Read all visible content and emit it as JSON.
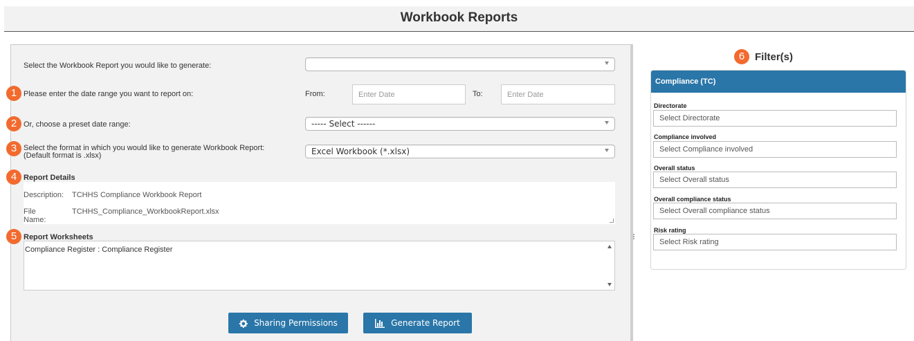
{
  "page": {
    "title": "Workbook Reports"
  },
  "form": {
    "report_select_label": "Select the Workbook Report you would like to generate:",
    "report_select_value": "",
    "date_range_label": "Please enter the date range you want to report on:",
    "from_label": "From:",
    "to_label": "To:",
    "from_placeholder": "Enter Date",
    "to_placeholder": "Enter Date",
    "preset_label": "Or, choose a preset date range:",
    "preset_value": "----- Select ------",
    "format_label_line1": "Select the format in which you would like to generate Workbook Report:",
    "format_label_line2": "(Default format is .xlsx)",
    "format_value": "Excel Workbook (*.xlsx)"
  },
  "badges": [
    "1",
    "2",
    "3",
    "4",
    "5",
    "6"
  ],
  "details": {
    "title": "Report Details",
    "description_label": "Description:",
    "description_value": "TCHHS Compliance Workbook Report",
    "filename_label": "File Name:",
    "filename_value": "TCHHS_Compliance_WorkbookReport.xlsx"
  },
  "worksheets": {
    "title": "Report Worksheets",
    "content": "Compliance Register : Compliance Register"
  },
  "buttons": {
    "sharing": "Sharing Permissions",
    "generate": "Generate Report"
  },
  "filters": {
    "title": "Filter(s)",
    "panel_title": "Compliance (TC)",
    "fields": [
      {
        "label": "Directorate",
        "placeholder": "Select Directorate"
      },
      {
        "label": "Compliance involved",
        "placeholder": "Select Compliance involved"
      },
      {
        "label": "Overall status",
        "placeholder": "Select Overall status"
      },
      {
        "label": "Overall compliance status",
        "placeholder": "Select Overall compliance status"
      },
      {
        "label": "Risk rating",
        "placeholder": "Select Risk rating"
      }
    ]
  },
  "colors": {
    "accent": "#2a76a8",
    "badge": "#f26a2e",
    "panel_bg": "#f2f2f2"
  },
  "icons": {
    "sharing": "gear-icon",
    "generate": "bar-chart-icon"
  }
}
